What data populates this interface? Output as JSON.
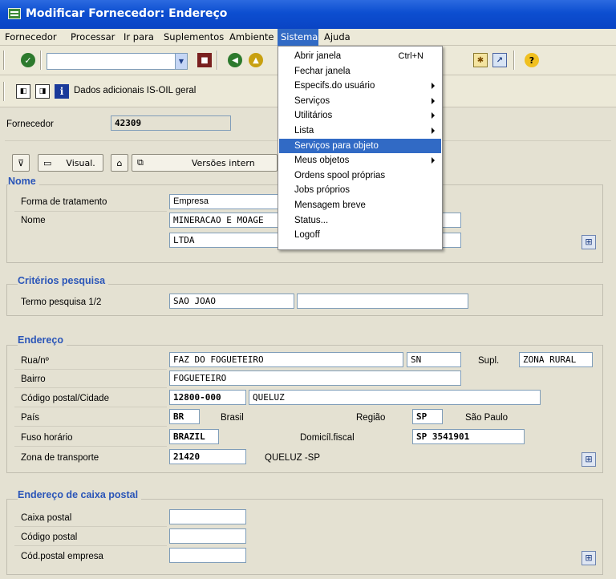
{
  "window": {
    "title": "Modificar Fornecedor: Endereço"
  },
  "menubar": {
    "items": [
      "Fornecedor",
      "Processar",
      "Ir para",
      "Suplementos",
      "Ambiente",
      "Sistema",
      "Ajuda"
    ]
  },
  "toolbar2": {
    "label": "Dados adicionais IS-OIL geral"
  },
  "header": {
    "vendor_label": "Fornecedor",
    "vendor_value": "42309"
  },
  "buttons": {
    "visual": "Visual.",
    "versions": "Versões intern"
  },
  "sections": {
    "nome": {
      "title": "Nome",
      "forma_label": "Forma de tratamento",
      "forma_value": "Empresa",
      "nome_label": "Nome",
      "nome_value1": "MINERACAO E MOAGE",
      "nome_value2": "LTDA"
    },
    "criterios": {
      "title": "Critérios pesquisa",
      "termo_label": "Termo pesquisa 1/2",
      "termo_value1": "SAO JOAO",
      "termo_value2": ""
    },
    "endereco": {
      "title": "Endereço",
      "rua_label": "Rua/nº",
      "rua_value": "FAZ DO FOGUETEIRO",
      "numero_value": "SN",
      "supl_label": "Supl.",
      "supl_value": "ZONA RURAL",
      "bairro_label": "Bairro",
      "bairro_value": "FOGUETEIRO",
      "cep_label": "Código postal/Cidade",
      "cep_value": "12800-000",
      "cidade_value": "QUELUZ",
      "pais_label": "País",
      "pais_value": "BR",
      "pais_name": "Brasil",
      "regiao_label": "Região",
      "regiao_value": "SP",
      "regiao_name": "São Paulo",
      "fuso_label": "Fuso horário",
      "fuso_value": "BRAZIL",
      "domicilio_label": "Domicíl.fiscal",
      "domicilio_value": "SP 3541901",
      "zona_label": "Zona de transporte",
      "zona_value": "21420",
      "zona_name": "QUELUZ -SP"
    },
    "caixa": {
      "title": "Endereço de caixa postal",
      "caixa_label": "Caixa postal",
      "codigo_label": "Código postal",
      "codemp_label": "Cód.postal empresa"
    }
  },
  "sistema_menu": {
    "items": [
      {
        "label": "Abrir janela",
        "shortcut": "Ctrl+N"
      },
      {
        "label": "Fechar janela"
      },
      {
        "label": "Especifs.do usuário"
      },
      {
        "label": "Serviços"
      },
      {
        "label": "Utilitários"
      },
      {
        "label": "Lista"
      },
      {
        "label": "Serviços para objeto"
      },
      {
        "label": "Meus objetos"
      },
      {
        "label": "Ordens spool próprias"
      },
      {
        "label": "Jobs próprios"
      },
      {
        "label": "Mensagem breve"
      },
      {
        "label": "Status..."
      },
      {
        "label": "Logoff"
      }
    ]
  },
  "colors": {
    "title_bar": "#0c4ed0",
    "highlight": "#316ac5",
    "section_title": "#2a55b8"
  }
}
